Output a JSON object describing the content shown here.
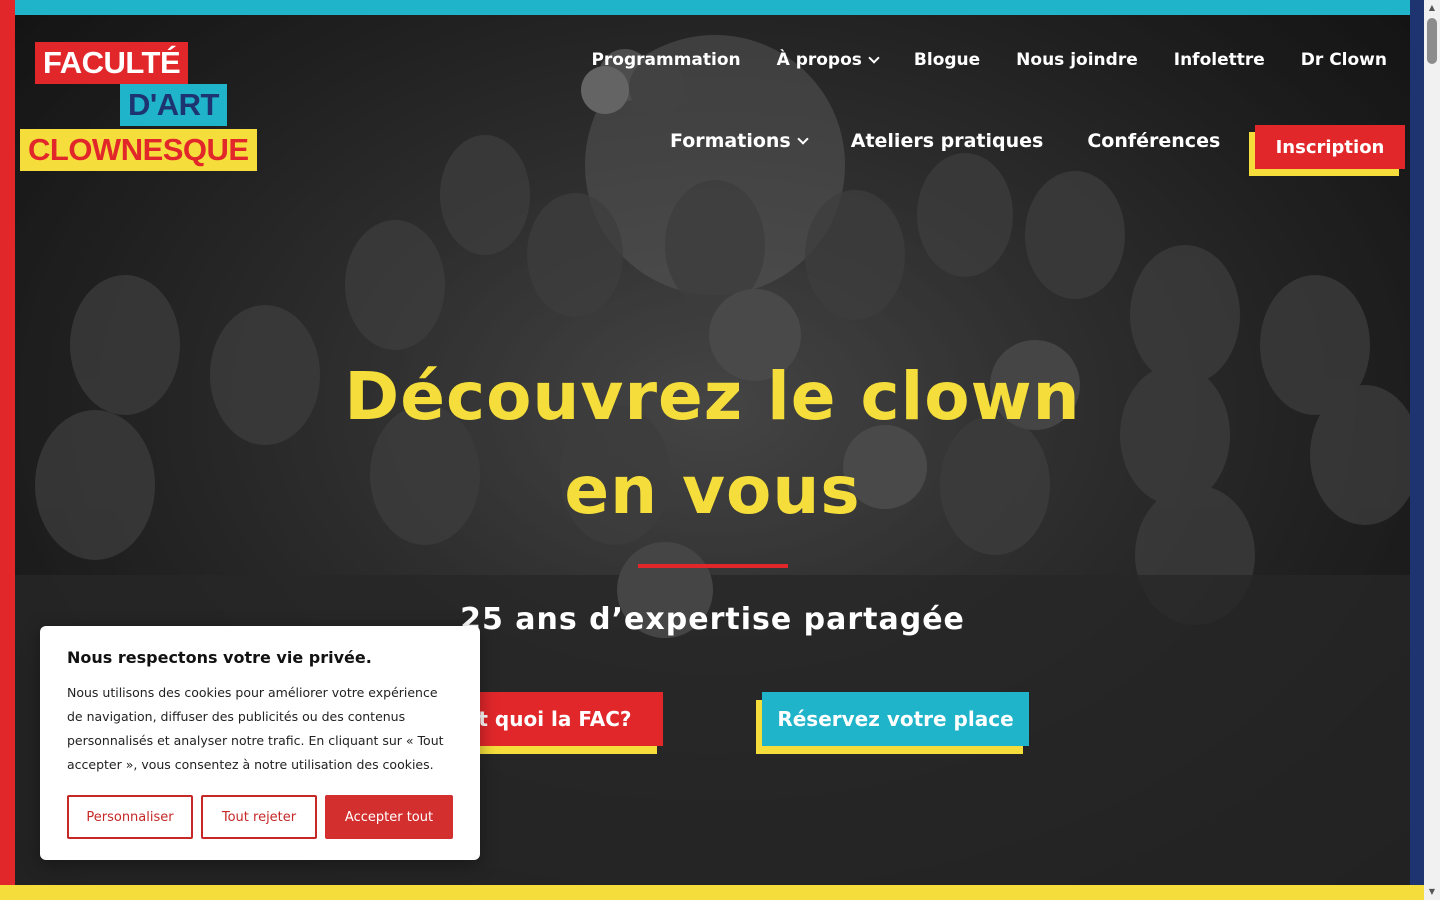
{
  "brand": {
    "line1": "FACULTÉ",
    "line2": "D'ART",
    "line3": "CLOWNESQUE"
  },
  "nav": {
    "row1": [
      {
        "label": "Programmation",
        "has_dropdown": false
      },
      {
        "label": "À propos",
        "has_dropdown": true
      },
      {
        "label": "Blogue",
        "has_dropdown": false
      },
      {
        "label": "Nous joindre",
        "has_dropdown": false
      },
      {
        "label": "Infolettre",
        "has_dropdown": false
      },
      {
        "label": "Dr Clown",
        "has_dropdown": false
      }
    ],
    "row2": [
      {
        "label": "Formations",
        "has_dropdown": true
      },
      {
        "label": "Ateliers pratiques",
        "has_dropdown": false
      },
      {
        "label": "Conférences",
        "has_dropdown": false
      }
    ],
    "cta_label": "Inscription"
  },
  "hero": {
    "title": "Découvrez le clown en vous",
    "subtitle": "25 ans d’expertise partagée",
    "cta_primary": "st quoi la FAC?",
    "cta_secondary": "Réservez votre place"
  },
  "cookie": {
    "title": "Nous respectons votre vie privée.",
    "body": "Nous utilisons des cookies pour améliorer votre expérience de navigation, diffuser des publicités ou des contenus personnalisés et analyser notre trafic. En cliquant sur « Tout accepter », vous consentez à notre utilisation des cookies.",
    "customize": "Personnaliser",
    "reject": "Tout rejeter",
    "accept": "Accepter tout"
  },
  "colors": {
    "red": "#e2272b",
    "cyan": "#1fb4c9",
    "yellow": "#f5de3b",
    "navy": "#1e3470"
  }
}
